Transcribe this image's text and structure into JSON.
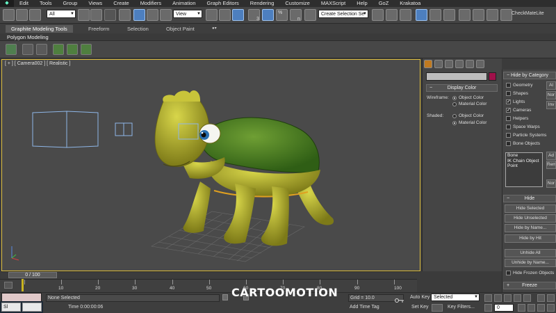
{
  "menubar": {
    "items": [
      "Edit",
      "Tools",
      "Group",
      "Views",
      "Create",
      "Modifiers",
      "Animation",
      "Graph Editors",
      "Rendering",
      "Customize",
      "MAXScript",
      "Help",
      "GoZ",
      "Krakatoa"
    ]
  },
  "toolbar": {
    "selection_filter": "All",
    "ref_coord": "View",
    "selection_set_placeholder": "Create Selection Se",
    "checkmate_label": "CheckMateLite",
    "snap_label": "3",
    "percent_label": "%",
    "angle_label": "n"
  },
  "ribbon": {
    "tabs": [
      "Graphite Modeling Tools",
      "Freeform",
      "Selection",
      "Object Paint"
    ],
    "active_tab": "Graphite Modeling Tools",
    "panel_label": "Polygon Modeling"
  },
  "viewport": {
    "label": "[ + ] [ Camera002 ] [ Realistic ]"
  },
  "display_color": {
    "title": "Display Color",
    "wireframe_label": "Wireframe:",
    "shaded_label": "Shaded:",
    "options": [
      "Object Color",
      "Material Color"
    ],
    "wireframe_selected": "Object Color",
    "shaded_selected": "Material Color"
  },
  "hide_by_category": {
    "title": "Hide by Category",
    "items": [
      {
        "label": "Geometry",
        "checked": false
      },
      {
        "label": "Shapes",
        "checked": false
      },
      {
        "label": "Lights",
        "checked": true
      },
      {
        "label": "Cameras",
        "checked": true
      },
      {
        "label": "Helpers",
        "checked": false
      },
      {
        "label": "Space Warps",
        "checked": false
      },
      {
        "label": "Particle Systems",
        "checked": false
      },
      {
        "label": "Bone Objects",
        "checked": false
      }
    ],
    "side_buttons": [
      "Al",
      "Nor",
      "Inv"
    ],
    "list_items": [
      "Bone",
      "IK Chain Object",
      "Point"
    ],
    "list_buttons": [
      "Ad",
      "Remo",
      "Nor"
    ]
  },
  "hide": {
    "title": "Hide",
    "buttons": [
      "Hide Selected",
      "Hide Unselected",
      "Hide by Name...",
      "Hide by Hit",
      "Unhide All",
      "Unhide by Name..."
    ],
    "frozen_label": "Hide Frozen Objects"
  },
  "freeze": {
    "title": "Freeze"
  },
  "timeline": {
    "frame_indicator": "0 / 100",
    "ticks": [
      "10",
      "20",
      "30",
      "40",
      "50",
      "60",
      "70",
      "80",
      "90",
      "100"
    ]
  },
  "status": {
    "selection": "None Selected",
    "time": "Time  0:00:00:06",
    "grid": "Grid = 10.0",
    "add_time_tag": "Add Time Tag",
    "auto_key": "Auto Key",
    "set_key": "Set Key",
    "key_mode": "Selected",
    "key_filters": "Key Filters...",
    "current_frame": "0"
  },
  "taskbar": {
    "buttons": [
      "Sl",
      ""
    ]
  },
  "watermark": "CARTOOMOTION",
  "colors": {
    "viewport_bg": "#4a4a4a",
    "active_border": "#e0c040",
    "accent_blue": "#4d7fbf",
    "turtle_body": "#b5b32a",
    "turtle_shell": "#4f7f22",
    "camera_wire": "#8fb7e8",
    "object_swatch": "#a0104a"
  }
}
